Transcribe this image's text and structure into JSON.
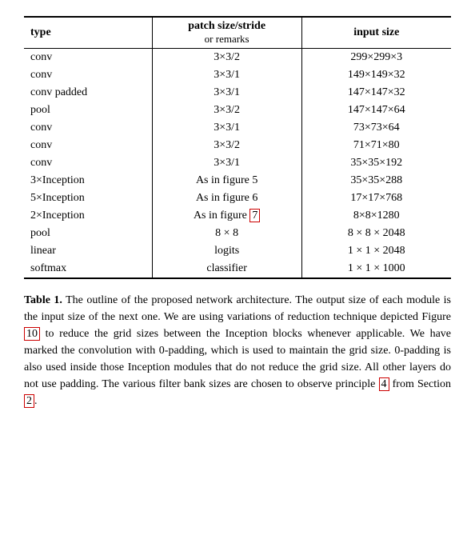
{
  "table": {
    "headers": {
      "col1": "type",
      "col2_main": "patch size/stride",
      "col2_sub": "or remarks",
      "col3": "input size"
    },
    "rows": [
      {
        "type": "conv",
        "patch": "3×3/2",
        "input": "299×299×3",
        "highlight": false
      },
      {
        "type": "conv",
        "patch": "3×3/1",
        "input": "149×149×32",
        "highlight": false
      },
      {
        "type": "conv padded",
        "patch": "3×3/1",
        "input": "147×147×32",
        "highlight": false
      },
      {
        "type": "pool",
        "patch": "3×3/2",
        "input": "147×147×64",
        "highlight": false
      },
      {
        "type": "conv",
        "patch": "3×3/1",
        "input": "73×73×64",
        "highlight": false
      },
      {
        "type": "conv",
        "patch": "3×3/2",
        "input": "71×71×80",
        "highlight": false
      },
      {
        "type": "conv",
        "patch": "3×3/1",
        "input": "35×35×192",
        "highlight": false
      },
      {
        "type": "3×Inception",
        "patch": "As in figure 5",
        "input": "35×35×288",
        "highlight": false,
        "ref_patch": true,
        "ref_num": "5"
      },
      {
        "type": "5×Inception",
        "patch": "As in figure 6",
        "input": "17×17×768",
        "highlight": false,
        "ref_patch": true,
        "ref_num": "6"
      },
      {
        "type": "2×Inception",
        "patch": "As in figure 7",
        "input": "8×8×1280",
        "highlight": true,
        "ref_patch": true,
        "ref_num": "7"
      },
      {
        "type": "pool",
        "patch": "8 × 8",
        "input": "8 × 8 × 2048",
        "highlight": false
      },
      {
        "type": "linear",
        "patch": "logits",
        "input": "1 × 1 × 2048",
        "highlight": false
      },
      {
        "type": "softmax",
        "patch": "classifier",
        "input": "1 × 1 × 1000",
        "highlight": false
      }
    ]
  },
  "caption": {
    "label": "Table 1.",
    "text": " The outline of the proposed network architecture.  The output size of each module is the input size of the next one.  We are using variations of reduction technique depicted Figure ",
    "ref1": "10",
    "text2": " to reduce the grid sizes between the Inception blocks whenever applicable.  We have marked the convolution with 0-padding, which is used to maintain the grid size.  0-padding is also used inside those Inception modules that do not reduce the grid size.  All other layers do not use padding.  The various filter bank sizes are chosen to observe principle ",
    "ref2": "4",
    "text3": " from Section ",
    "ref3": "2",
    "text4": "."
  }
}
